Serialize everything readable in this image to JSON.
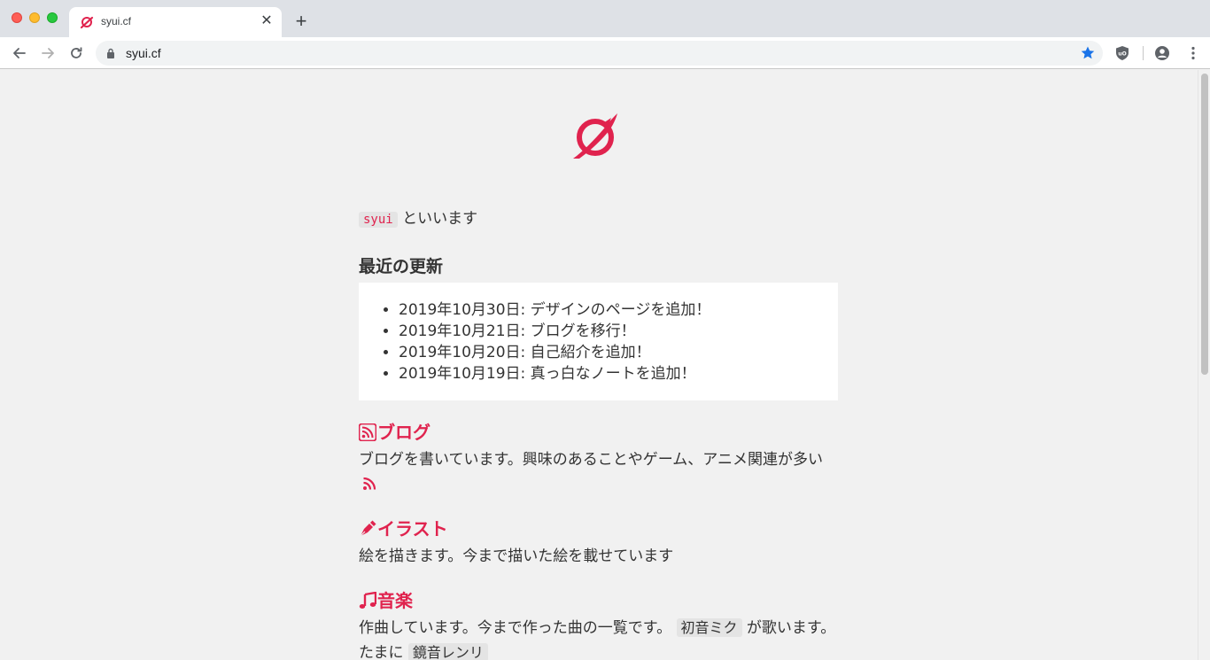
{
  "browser": {
    "tab_title": "syui.cf",
    "tab_close": "✕",
    "new_tab": "+",
    "url": "syui.cf"
  },
  "colors": {
    "accent": "#e0234e",
    "page_bg": "#f1f1f1",
    "text": "#333333"
  },
  "page": {
    "intro_code": "syui",
    "intro_text": "といいます",
    "recent_title": "最近の更新",
    "updates": [
      "2019年10月30日: デザインのページを追加！",
      "2019年10月21日: ブログを移行！",
      "2019年10月20日: 自己紹介を追加！",
      "2019年10月19日: 真っ白なノートを追加！"
    ],
    "sections": {
      "blog": {
        "title": "ブログ",
        "desc": "ブログを書いています。興味のあることやゲーム、アニメ関連が多い",
        "icon": "rss-icon"
      },
      "illust": {
        "title": "イラスト",
        "desc": "絵を描きます。今まで描いた絵を載せています",
        "icon": "pen-icon"
      },
      "music": {
        "title": "音楽",
        "desc_before": "作曲しています。今まで作った曲の一覧です。",
        "code1": "初音ミク",
        "desc_middle": "が歌います。たまに",
        "code2": "鏡音レンリ",
        "icon": "music-note-icon"
      }
    }
  }
}
